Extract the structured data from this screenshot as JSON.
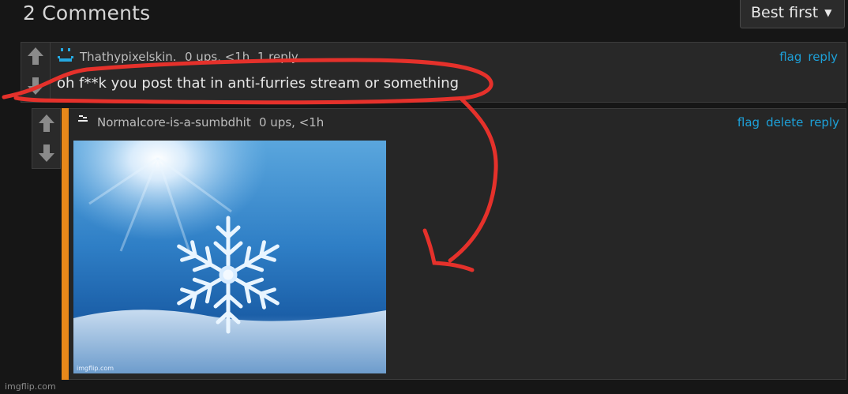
{
  "header": {
    "title": "2 Comments",
    "sort_label": "Best first"
  },
  "comment1": {
    "username": "Thathypixelskin.",
    "meta": "0 ups, <1h, 1 reply",
    "actions": {
      "flag": "flag",
      "reply": "reply"
    },
    "text": "oh f**k you post that in anti-furries stream or something",
    "avatar_color": "#25a8e0"
  },
  "comment2": {
    "username": "Normalcore-is-a-sumbdhit",
    "meta": "0 ups, <1h",
    "actions": {
      "flag": "flag",
      "delete": "delete",
      "reply": "reply"
    },
    "image_caption": "imgflip.com",
    "accent_color": "#e8881a"
  },
  "footer": {
    "watermark": "imgflip.com"
  },
  "colors": {
    "link": "#1da1d9",
    "annotation": "#e5312b",
    "background": "#161616"
  }
}
